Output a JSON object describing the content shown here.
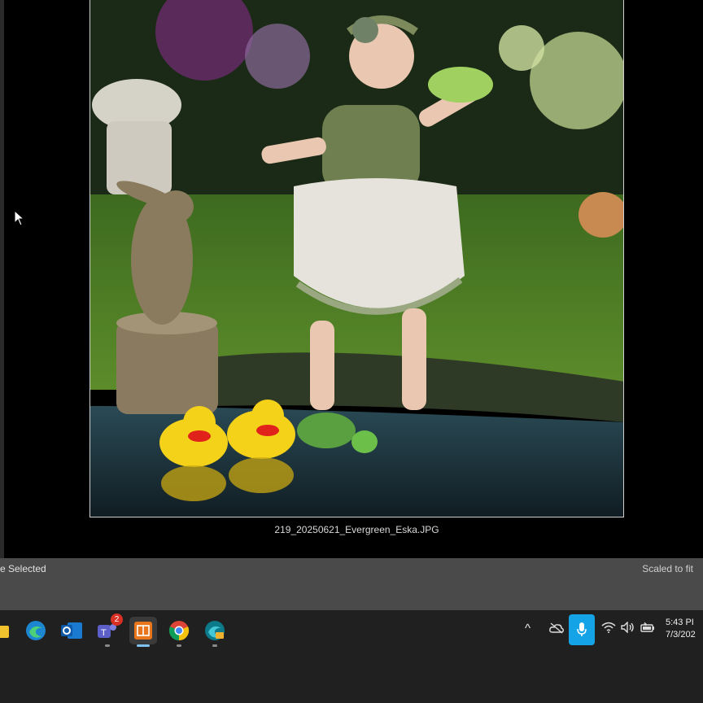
{
  "viewer": {
    "filename": "219_20250621_Evergreen_Eska.JPG"
  },
  "status_bar": {
    "left_text": "e Selected",
    "right_text": "Scaled to fit"
  },
  "taskbar": {
    "apps": [
      {
        "name": "file-explorer-icon"
      },
      {
        "name": "edge-icon"
      },
      {
        "name": "outlook-icon"
      },
      {
        "name": "teams-icon",
        "badge": "2"
      },
      {
        "name": "photo-app-icon"
      },
      {
        "name": "chrome-icon"
      },
      {
        "name": "edge-dev-icon"
      }
    ],
    "tray": {
      "chevron": "^",
      "clock_time": "5:43 PI",
      "clock_date": "7/3/202"
    }
  },
  "colors": {
    "accent_blue": "#14a3e6",
    "status_bar": "#4a4a4a",
    "taskbar": "#202020"
  }
}
